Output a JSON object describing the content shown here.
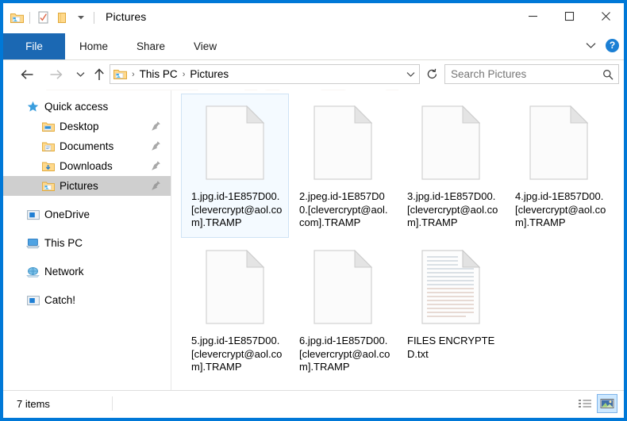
{
  "window": {
    "title": "Pictures",
    "border_color": "#0078d7",
    "quick_access_toolbar": [
      {
        "name": "pictures-folder-icon",
        "label": "Pictures"
      },
      {
        "name": "properties-icon",
        "label": "Properties"
      },
      {
        "name": "new-folder-icon",
        "label": "New folder"
      },
      {
        "name": "customize-dropdown-icon",
        "label": "Customize Quick Access Toolbar"
      }
    ],
    "controls": {
      "minimize": "Minimize",
      "maximize": "Maximize",
      "close": "Close"
    }
  },
  "ribbon": {
    "tabs": [
      {
        "label": "File",
        "active": true
      },
      {
        "label": "Home",
        "active": false
      },
      {
        "label": "Share",
        "active": false
      },
      {
        "label": "View",
        "active": false
      }
    ],
    "active_tab_bg": "#1b68b3",
    "expand_label": "Expand the Ribbon",
    "help_label": "?"
  },
  "navbar": {
    "back_label": "Back",
    "forward_label": "Forward",
    "recent_label": "Recent locations",
    "up_label": "Up",
    "breadcrumbs": [
      {
        "label": "This PC"
      },
      {
        "label": "Pictures"
      }
    ],
    "separator": "›",
    "refresh_label": "Refresh",
    "dropdown_label": "Previous locations"
  },
  "search": {
    "placeholder": "Search Pictures",
    "value": "",
    "icon": "search-icon"
  },
  "sidebar": {
    "items": [
      {
        "label": "Quick access",
        "icon": "star-icon",
        "level": 0,
        "pinned": false,
        "selected": false
      },
      {
        "label": "Desktop",
        "icon": "desktop-folder-icon",
        "level": 1,
        "pinned": true,
        "selected": false
      },
      {
        "label": "Documents",
        "icon": "documents-folder-icon",
        "level": 1,
        "pinned": true,
        "selected": false
      },
      {
        "label": "Downloads",
        "icon": "downloads-folder-icon",
        "level": 1,
        "pinned": true,
        "selected": false
      },
      {
        "label": "Pictures",
        "icon": "pictures-folder-icon",
        "level": 1,
        "pinned": true,
        "selected": true
      },
      {
        "label": "OneDrive",
        "icon": "onedrive-icon",
        "level": 0,
        "pinned": false,
        "selected": false
      },
      {
        "label": "This PC",
        "icon": "this-pc-icon",
        "level": 0,
        "pinned": false,
        "selected": false
      },
      {
        "label": "Network",
        "icon": "network-icon",
        "level": 0,
        "pinned": false,
        "selected": false
      },
      {
        "label": "Catch!",
        "icon": "catch-drive-icon",
        "level": 0,
        "pinned": false,
        "selected": false
      }
    ]
  },
  "files": [
    {
      "name": "1.jpg.id-1E857D00.[clevercrypt@aol.com].TRAMP",
      "icon": "blank-file-icon",
      "selected": true
    },
    {
      "name": "2.jpeg.id-1E857D00.[clevercrypt@aol.com].TRAMP",
      "icon": "blank-file-icon",
      "selected": false
    },
    {
      "name": "3.jpg.id-1E857D00.[clevercrypt@aol.com].TRAMP",
      "icon": "blank-file-icon",
      "selected": false
    },
    {
      "name": "4.jpg.id-1E857D00.[clevercrypt@aol.com].TRAMP",
      "icon": "blank-file-icon",
      "selected": false
    },
    {
      "name": "5.jpg.id-1E857D00.[clevercrypt@aol.com].TRAMP",
      "icon": "blank-file-icon",
      "selected": false
    },
    {
      "name": "6.jpg.id-1E857D00.[clevercrypt@aol.com].TRAMP",
      "icon": "blank-file-icon",
      "selected": false
    },
    {
      "name": "FILES ENCRYPTED.txt",
      "icon": "text-file-icon",
      "selected": false
    }
  ],
  "statusbar": {
    "item_count": "7 items",
    "views": [
      {
        "name": "details-view-button",
        "label": "Details view",
        "active": false
      },
      {
        "name": "large-icons-view-button",
        "label": "Large icons view",
        "active": true
      }
    ]
  }
}
